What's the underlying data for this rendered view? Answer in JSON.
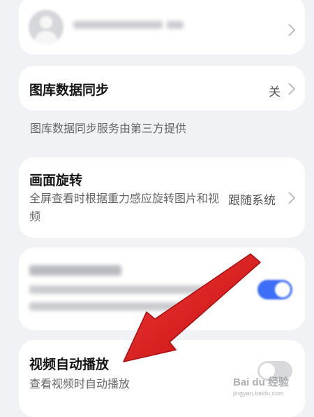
{
  "account": {
    "name_label": "",
    "colors": {
      "avatar": "#d5d7db",
      "blurred_text": "#c9cbd0"
    }
  },
  "gallery_sync": {
    "title": "图库数据同步",
    "value": "关",
    "footnote": "图库数据同步服务由第三方提供"
  },
  "rotation": {
    "title": "画面旋转",
    "description": "全屏查看时根据重力感应旋转图片和视频",
    "value": "跟随系统"
  },
  "blurred_setting": {
    "title": "",
    "description": "",
    "toggle_on": true,
    "toggle_color": "#3d6ef7"
  },
  "video_autoplay": {
    "title": "视频自动播放",
    "description": "查看视频时自动播放",
    "toggle_on": false,
    "toggle_color": "#d8d9dc"
  },
  "watermark": {
    "text": "Bai du 经验",
    "subtext": "jingyan.baidu.com"
  },
  "annotation": {
    "arrow_color": "#e21414"
  },
  "icons": {
    "chevron": "chevron-right-icon",
    "avatar": "avatar-icon",
    "arrow": "arrow-annotation-icon"
  }
}
